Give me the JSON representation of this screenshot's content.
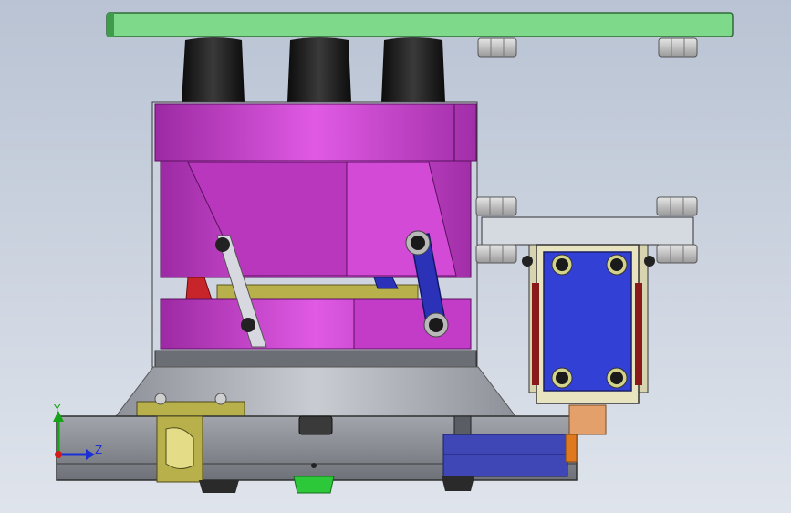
{
  "viewport": {
    "background_top": "#b9c3d3",
    "background_bottom": "#dfe4ec"
  },
  "triad": {
    "y_label": "Y",
    "z_label": "Z",
    "y_color": "#16a316",
    "z_color": "#1a2fd6",
    "x_color": "#d61a1a"
  },
  "colors": {
    "top_plate": "#7fd98a",
    "nut": "#c8c8c8",
    "rubber_foot": "#1a1a1a",
    "magenta_body": "#c33cc8",
    "magenta_light": "#e05ae4",
    "glass": "#cfd6e0",
    "base_cone": "#a9adb5",
    "base_beam": "#8c8f96",
    "olive_bracket": "#b8b04a",
    "blue_link": "#2b32b8",
    "red_link": "#c8252a",
    "module_blue": "#3340d6",
    "module_frame": "#e8e4c0",
    "copper": "#e3a06a",
    "green_foot": "#2cc83a"
  }
}
